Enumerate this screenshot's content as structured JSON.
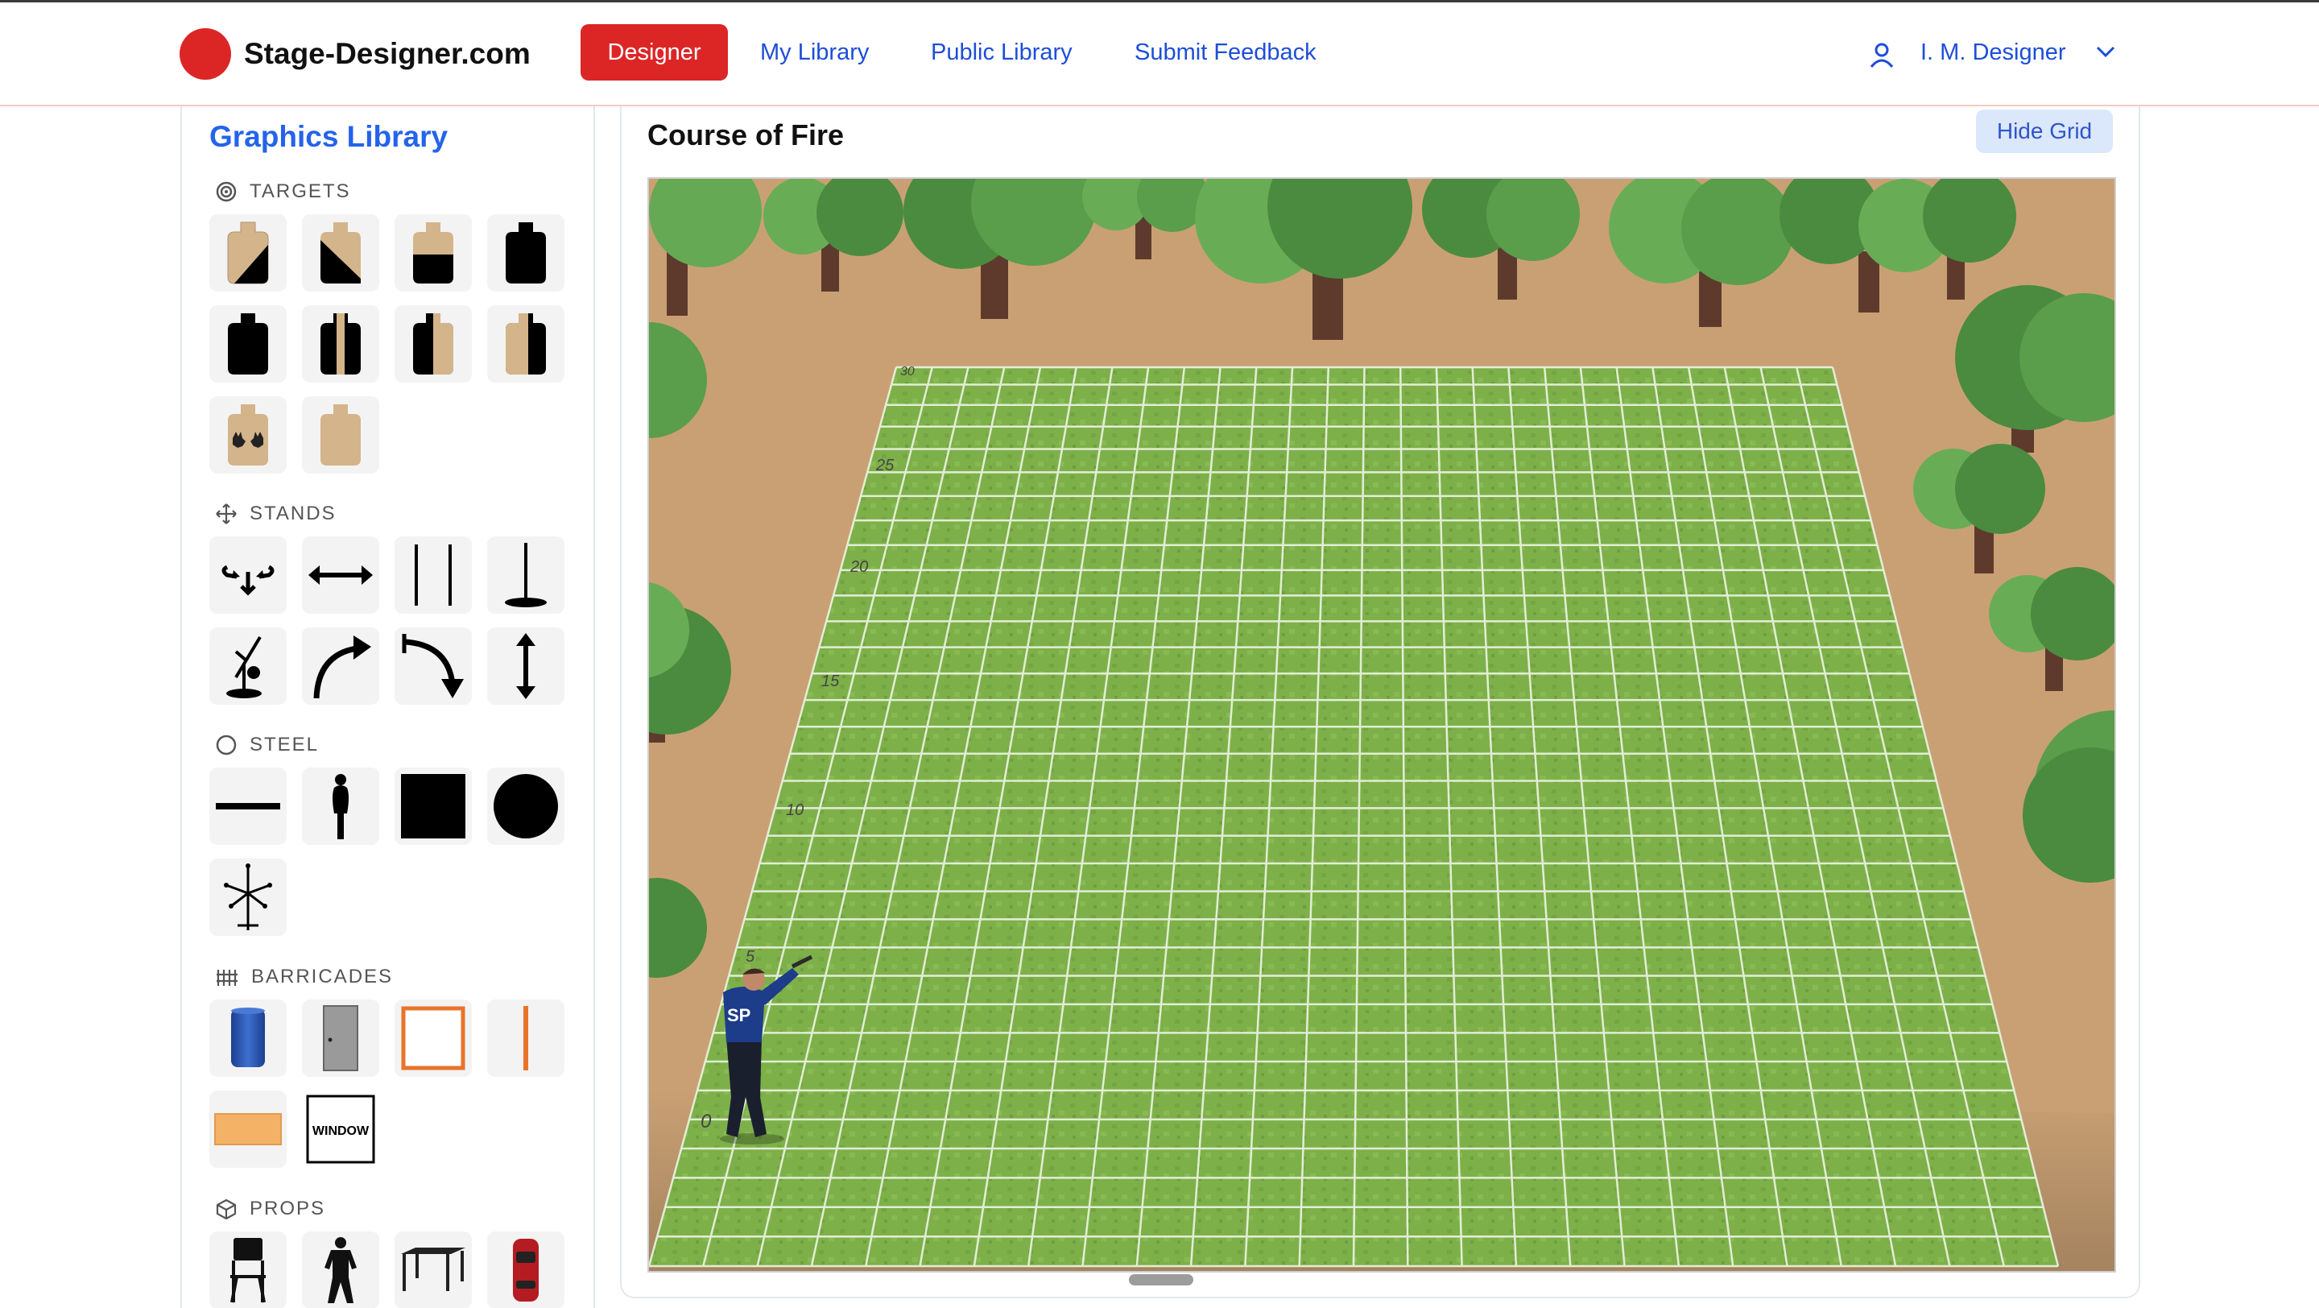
{
  "header": {
    "brand": "Stage-Designer.com",
    "nav": {
      "designer": "Designer",
      "my_library": "My Library",
      "public_library": "Public Library",
      "feedback": "Submit Feedback"
    },
    "user": "I. M. Designer",
    "colors": {
      "brand_red": "#dc2626",
      "link_blue": "#1d4ed8"
    }
  },
  "sidebar": {
    "title": "Graphics Library",
    "sections": {
      "targets": "TARGETS",
      "stands": "STANDS",
      "steel": "STEEL",
      "barricades": "BARRICADES",
      "props": "PROPS"
    },
    "window_label": "WINDOW"
  },
  "main": {
    "title": "Course of Fire",
    "hide_grid": "Hide Grid",
    "distance_labels": [
      "0",
      "5",
      "10",
      "15",
      "20",
      "25",
      "30"
    ],
    "shooter_badge": "SP"
  }
}
